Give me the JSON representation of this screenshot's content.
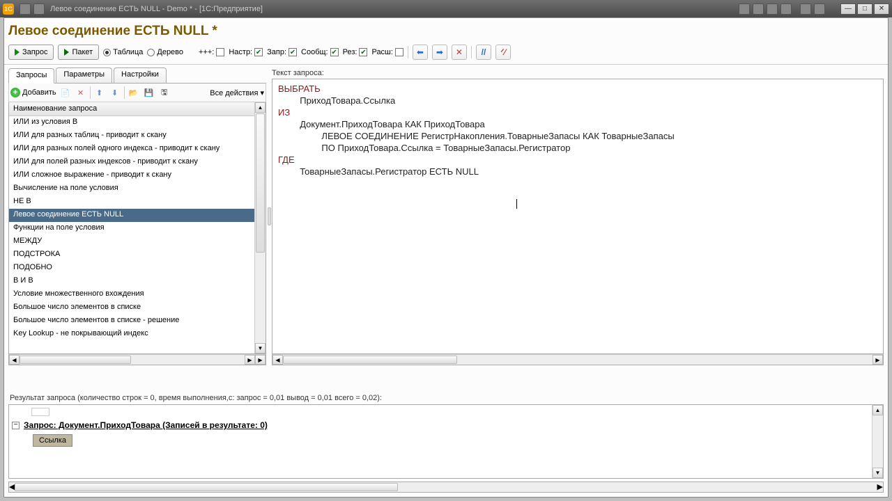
{
  "window": {
    "title": "Левое соединение ЕСТЬ NULL - Demo * - [1С:Предприятие]"
  },
  "page": {
    "title": "Левое соединение ЕСТЬ NULL *"
  },
  "toolbar": {
    "zapros": "Запрос",
    "paket": "Пакет",
    "radio_table": "Таблица",
    "radio_tree": "Дерево",
    "ppp": "+++:",
    "nastr": "Настр:",
    "zapr": "Запр:",
    "soobsh": "Сообщ:",
    "res": "Рез:",
    "rassh": "Расш:",
    "nastr_checked": true,
    "zapr_checked": true,
    "soobsh_checked": true,
    "res_checked": true,
    "rassh_checked": false
  },
  "tabs": {
    "t1": "Запросы",
    "t2": "Параметры",
    "t3": "Настройки"
  },
  "left_toolbar": {
    "add": "Добавить",
    "all_actions": "Все действия ▾"
  },
  "list": {
    "header": "Наименование запроса",
    "items": [
      "ИЛИ из условия В",
      "ИЛИ для разных таблиц - приводит к скану",
      "ИЛИ для разных полей одного индекса - приводит к скану",
      "ИЛИ для полей разных индексов - приводит к скану",
      "ИЛИ сложное выражение - приводит к скану",
      "Вычисление на поле условия",
      "НЕ В",
      "Левое соединение ЕСТЬ NULL",
      "Функции на поле условия",
      "МЕЖДУ",
      "ПОДСТРОКА",
      "ПОДОБНО",
      "В И В",
      "Условие множественного вхождения",
      "Большое число элементов в списке",
      "Большое число элементов в списке - решение",
      "Key Lookup - не покрывающий индекс"
    ],
    "selected_index": 7
  },
  "editor": {
    "label": "Текст запроса:",
    "lines": [
      {
        "indent": 0,
        "kw": true,
        "text": "ВЫБРАТЬ"
      },
      {
        "indent": 1,
        "kw": false,
        "text": "ПриходТовара.Ссылка"
      },
      {
        "indent": 0,
        "kw": true,
        "text": "ИЗ"
      },
      {
        "indent": 1,
        "kw": false,
        "text": "Документ.ПриходТовара КАК ПриходТовара"
      },
      {
        "indent": 2,
        "kw": false,
        "text": "ЛЕВОЕ СОЕДИНЕНИЕ РегистрНакопления.ТоварныеЗапасы КАК ТоварныеЗапасы"
      },
      {
        "indent": 2,
        "kw": false,
        "text": "ПО ПриходТовара.Ссылка = ТоварныеЗапасы.Регистратор"
      },
      {
        "indent": 0,
        "kw": true,
        "text": "ГДЕ"
      },
      {
        "indent": 1,
        "kw": false,
        "text": "ТоварныеЗапасы.Регистратор ЕСТЬ NULL"
      }
    ]
  },
  "status": {
    "text": "Результат запроса (количество строк = 0, время выполнения,с: запрос = 0,01  вывод = 0,01  всего = 0,02):"
  },
  "result": {
    "query_label": "Запрос: Документ.ПриходТовара (Записей в результате: 0)",
    "col1": "Ссылка"
  }
}
